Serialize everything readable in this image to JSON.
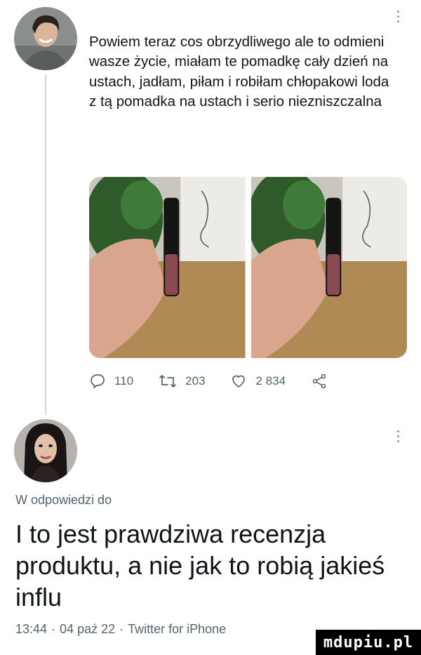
{
  "tweet": {
    "text": "Powiem teraz cos obrzydliwego ale to odmieni wasze życie, miałam te pomadkę cały dzień na ustach, jadłam, piłam i robiłam chłopakowi loda z tą pomadka na ustach i serio niezniszczalna",
    "stats": {
      "replies": "110",
      "retweets": "203",
      "likes": "2 834"
    }
  },
  "reply": {
    "replying_to_label": "W odpowiedzi do",
    "text": "I to jest prawdziwa recenzja produktu, a nie jak to robią jakieś influ",
    "time": "13:44",
    "date": "04 paź 22",
    "source": "Twitter for iPhone"
  },
  "watermark": "mdupiu.pl",
  "icons": {
    "reply": "speech-bubble-icon",
    "retweet": "retweet-icon",
    "like": "heart-icon",
    "share": "share-icon",
    "more": "more-dots-icon"
  },
  "colors": {
    "text": "#0f1419",
    "muted": "#536471",
    "divider": "#cfd9de"
  }
}
